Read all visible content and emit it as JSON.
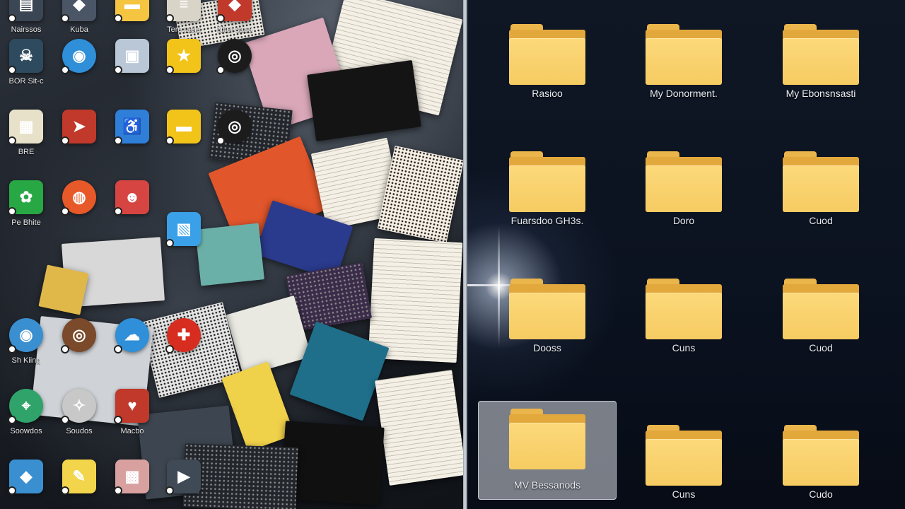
{
  "desktop": {
    "icons": [
      {
        "label": "Nairssos",
        "icon": "document-icon",
        "color": "#3b4654"
      },
      {
        "label": "Kuba",
        "icon": "app-icon",
        "color": "#4a5566"
      },
      {
        "label": "",
        "icon": "folder-icon",
        "color": "#f5c542"
      },
      {
        "label": "Tere tasie",
        "icon": "paper-icon",
        "color": "#d9d4c8"
      },
      {
        "label": "Niter saua",
        "icon": "app-icon",
        "color": "#c0392b"
      },
      {
        "label": "BOR Sit-c",
        "icon": "skull-icon",
        "color": "#2e4a5e"
      },
      {
        "label": "",
        "icon": "globe-icon",
        "color": "#2f8fd8"
      },
      {
        "label": "",
        "icon": "printer-icon",
        "color": "#b9c7d6"
      },
      {
        "label": "",
        "icon": "star-icon",
        "color": "#f2c318"
      },
      {
        "label": "",
        "icon": "camera-icon",
        "color": "#1c1c1c"
      },
      {
        "label": "BRE",
        "icon": "image-icon",
        "color": "#e7e1c9"
      },
      {
        "label": "",
        "icon": "arrow-icon",
        "color": "#c0392b"
      },
      {
        "label": "",
        "icon": "accessibility-icon",
        "color": "#2f7fd8"
      },
      {
        "label": "",
        "icon": "folder-icon",
        "color": "#f2c318"
      },
      {
        "label": "",
        "icon": "camera-icon",
        "color": "#1c1c1c"
      },
      {
        "label": "Pe Bhite",
        "icon": "leaf-icon",
        "color": "#27a844"
      },
      {
        "label": "",
        "icon": "browser-icon",
        "color": "#e8592a"
      },
      {
        "label": "",
        "icon": "game-icon",
        "color": "#d64541"
      },
      {
        "label": "",
        "icon": "picture-icon",
        "color": "#3aa0e8"
      },
      {
        "label": "Sh Kiing",
        "icon": "globe-icon",
        "color": "#3a8fd0"
      },
      {
        "label": "",
        "icon": "camera-icon",
        "color": "#7a4a2a"
      },
      {
        "label": "",
        "icon": "cloud-icon",
        "color": "#2f8fd8"
      },
      {
        "label": "",
        "icon": "plus-icon",
        "color": "#d62d20"
      },
      {
        "label": "Soowdos",
        "icon": "map-icon",
        "color": "#2fa36a"
      },
      {
        "label": "Soudos",
        "icon": "compass-icon",
        "color": "#c8c8c8"
      },
      {
        "label": "Macbo",
        "icon": "heart-icon",
        "color": "#c0392b"
      },
      {
        "label": "",
        "icon": "app-icon",
        "color": "#3a8fd0"
      },
      {
        "label": "",
        "icon": "note-icon",
        "color": "#f2d54a"
      },
      {
        "label": "",
        "icon": "photo-icon",
        "color": "#d9a0a0"
      },
      {
        "label": "",
        "icon": "video-icon",
        "color": "#3f4a56"
      }
    ]
  },
  "folders": [
    {
      "label": "Rasioo",
      "selected": false
    },
    {
      "label": "My Donorment.",
      "selected": false
    },
    {
      "label": "My Ebonsnsasti",
      "selected": false
    },
    {
      "label": "Fuarsdoo GH3s.",
      "selected": false
    },
    {
      "label": "Doro",
      "selected": false
    },
    {
      "label": "Cuod",
      "selected": false
    },
    {
      "label": "Dooss",
      "selected": false
    },
    {
      "label": "Cuns",
      "selected": false
    },
    {
      "label": "Cuod",
      "selected": false
    },
    {
      "label": "MV Bessanods",
      "selected": true
    },
    {
      "label": "Cuns",
      "selected": false
    },
    {
      "label": "Cudo",
      "selected": false
    }
  ]
}
